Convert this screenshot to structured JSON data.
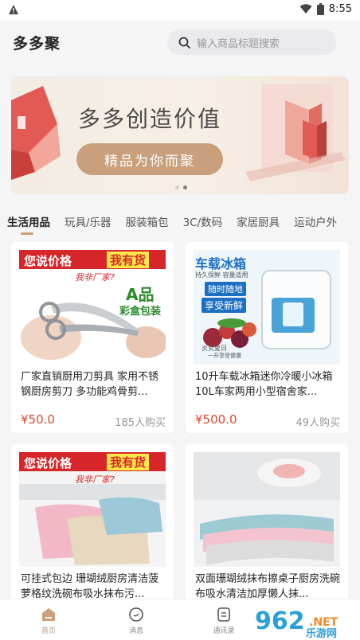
{
  "status": {
    "time": "8:55"
  },
  "header": {
    "title": "多多聚",
    "search_placeholder": "输入商品标题搜索"
  },
  "banner": {
    "title": "多多创造价值",
    "button": "精品为你而聚",
    "slide_count": 2,
    "active_slide": 2
  },
  "tabs": [
    "生活用品",
    "玩具/乐器",
    "服装箱包",
    "3C/数码",
    "家居厨具",
    "运动户外"
  ],
  "products": [
    {
      "name": "厂家直销厨用刀剪具 家用不锈钢厨房剪刀 多功能鸡骨剪...",
      "price": "¥50.0",
      "sold": "185人购买",
      "img_text": {
        "left": "您说价格",
        "right": "我有货",
        "tag": "我非厂家?",
        "badge": "A品",
        "sub": "彩盒包装"
      }
    },
    {
      "name": "10升车载冰箱迷你冷暖小冰箱10L车家两用小型宿舍家...",
      "price": "¥500.0",
      "sold": "49人购买",
      "img_text": {
        "title": "车载冰箱",
        "sub": "持久保鲜 容量适用",
        "tag1": "随时随地",
        "tag2": "享受新鲜",
        "note1": "炎炎夏日",
        "note2": "一开享受健康"
      }
    },
    {
      "name": "可挂式包边 珊瑚绒厨房清洁菠萝格纹洗碗布吸水抹布污...",
      "price": "",
      "sold": "",
      "img_text": {
        "left": "您说价格",
        "right": "我有货",
        "tag": "我非厂家?"
      }
    },
    {
      "name": "双面珊瑚绒抹布擦桌子厨房洗碗布吸水清洁加厚懒人抹...",
      "price": "",
      "sold": "",
      "img_text": {}
    }
  ],
  "nav": [
    {
      "label": "首页",
      "icon": "home-icon",
      "active": true
    },
    {
      "label": "消息",
      "icon": "message-icon",
      "active": false
    },
    {
      "label": "通讯录",
      "icon": "contacts-icon",
      "active": false
    }
  ],
  "watermark": "962乐游网",
  "colors": {
    "accent": "#c9a07b",
    "price": "#e0482c"
  }
}
